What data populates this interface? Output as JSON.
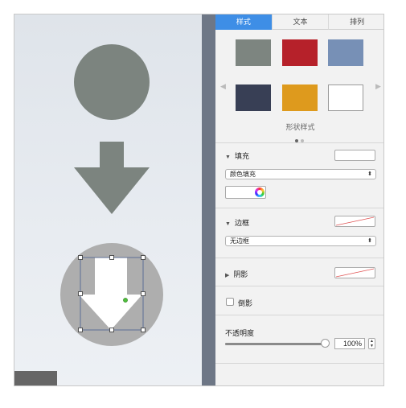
{
  "tabs": [
    {
      "label": "样式",
      "active": true
    },
    {
      "label": "文本",
      "active": false
    },
    {
      "label": "排列",
      "active": false
    }
  ],
  "shape_styles": {
    "caption": "形状样式",
    "swatches": [
      {
        "color": "#7d8580"
      },
      {
        "color": "#b6212a"
      },
      {
        "color": "#7790b6"
      },
      {
        "color": "#383f55"
      },
      {
        "color": "#de9a1d"
      },
      {
        "color": "#ffffff"
      }
    ],
    "page_count": 2,
    "current_page": 1
  },
  "fill": {
    "label": "填充",
    "type_value": "颜色填充",
    "color": "#ffffff"
  },
  "border": {
    "label": "边框",
    "type_value": "无边框"
  },
  "shadow": {
    "label": "阴影"
  },
  "reflection": {
    "label": "倒影",
    "checked": false
  },
  "opacity": {
    "label": "不透明度",
    "value": "100%",
    "level": 100
  },
  "canvas": {
    "circle_color": "#7c847f",
    "arrow_color": "#7c847f",
    "selected_shape_bg": "#aeaeae",
    "selected_arrow_color": "#ffffff",
    "selection_color": "#5c6f95"
  }
}
